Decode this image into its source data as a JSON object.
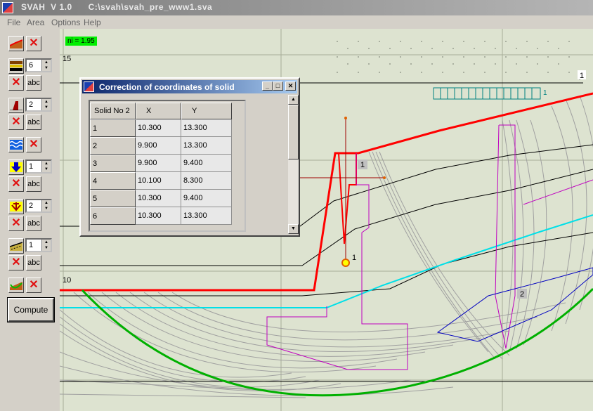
{
  "window": {
    "title": "SVAH  V 1.0      C:\\svah\\svah_pre_www1.sva"
  },
  "menu": [
    "File",
    "Area",
    "Options",
    "Help"
  ],
  "toolbar": {
    "spin1": "6",
    "spin2": "2",
    "spin3": "1",
    "spin4": "2",
    "spin5": "1",
    "abc": "abc",
    "compute": "Compute"
  },
  "canvas": {
    "ni_badge": "ni = 1.95",
    "ylabel_top": "15",
    "ylabel_bottom": "10",
    "label_1_right": "1",
    "label_1_box": "1",
    "label_1_anchor": "1",
    "label_2_box": "2",
    "label_1_small": "1"
  },
  "dialog": {
    "title": "Correction of coordinates of solid",
    "columns": [
      "Solid No  2",
      "X",
      "Y"
    ],
    "rows": [
      {
        "n": "1",
        "x": "10.300",
        "y": "13.300"
      },
      {
        "n": "2",
        "x": "9.900",
        "y": "13.300"
      },
      {
        "n": "3",
        "x": "9.900",
        "y": "9.400"
      },
      {
        "n": "4",
        "x": "10.100",
        "y": "8.300"
      },
      {
        "n": "5",
        "x": "10.300",
        "y": "9.400"
      },
      {
        "n": "6",
        "x": "10.300",
        "y": "13.300"
      }
    ]
  },
  "colors": {
    "canvas_bg": "#dde3d0",
    "red_line": "#ff0000",
    "green_arc": "#00b000",
    "cyan_line": "#00e0e8",
    "magenta_line": "#c000c0",
    "blue_line": "#0000c0"
  }
}
